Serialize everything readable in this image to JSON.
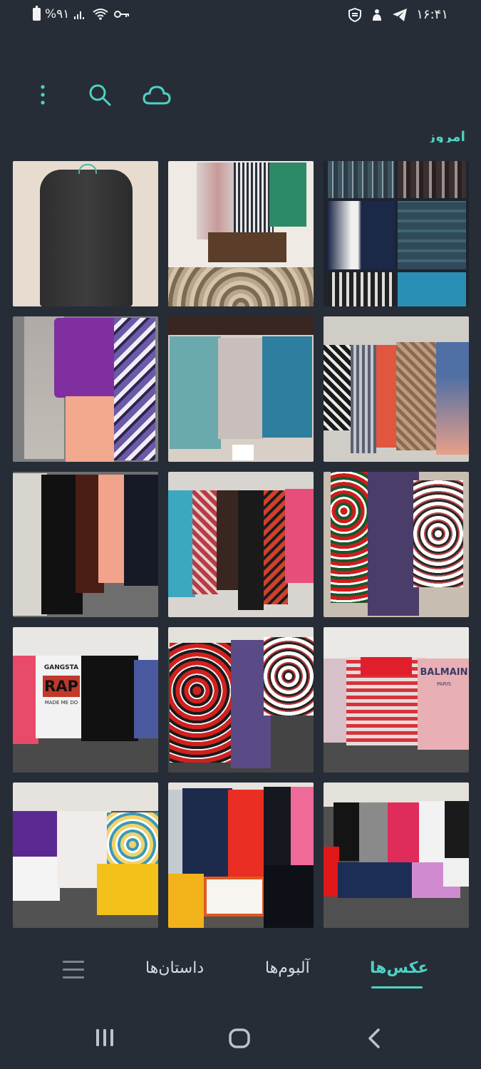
{
  "status": {
    "battery": "%۹۱",
    "time": "۱۶:۴۱"
  },
  "toolbar": {
    "more_icon": "more-vertical-icon",
    "search_icon": "search-icon",
    "cloud_icon": "cloud-icon"
  },
  "section": {
    "title": "امروز"
  },
  "photos": [
    {
      "label": "black denim jacket"
    },
    {
      "label": "three shirts on hangers"
    },
    {
      "label": "coats collage"
    },
    {
      "label": "purple and pink clothes"
    },
    {
      "label": "three blouses"
    },
    {
      "label": "patterned scarves"
    },
    {
      "label": "pants laid out"
    },
    {
      "label": "colorful scarves"
    },
    {
      "label": "floral dresses"
    },
    {
      "label": "t-shirts on sofa"
    },
    {
      "label": "floral and purple dresses"
    },
    {
      "label": "striped and printed tops"
    },
    {
      "label": "purple and floral tops"
    },
    {
      "label": "shirts and orange box"
    },
    {
      "label": "printed t-shirts"
    }
  ],
  "photo_texts": {
    "gangsta": "GANGSTA",
    "rap": "RAP",
    "made": "MADE ME DO",
    "balmain": "BALMAIN",
    "paris": "PARIS"
  },
  "tabs": {
    "photos": "عکس‌ها",
    "albums": "آلبوم‌ها",
    "stories": "داستان‌ها"
  },
  "colors": {
    "background": "#272d36",
    "accent": "#4fd1c5"
  }
}
